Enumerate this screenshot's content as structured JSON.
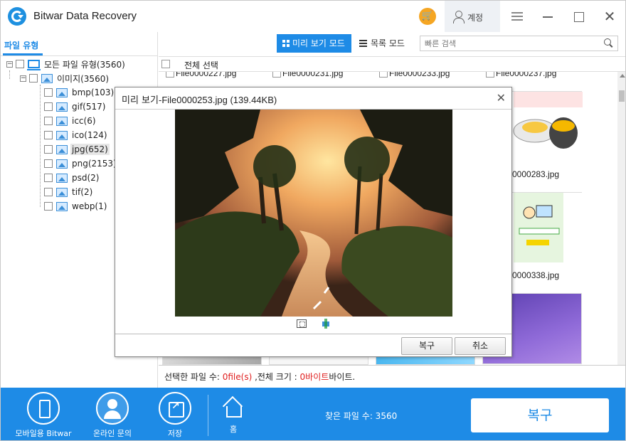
{
  "app": {
    "title": "Bitwar Data Recovery",
    "account_label": "계정"
  },
  "left_panel": {
    "tab_label": "파일 유형",
    "root": {
      "label": "모든 파일 유형(3560)",
      "expander": "−"
    },
    "group": {
      "label": "이미지(3560)",
      "expander": "−"
    },
    "items": [
      {
        "label": "bmp(103)"
      },
      {
        "label": "gif(517)"
      },
      {
        "label": "icc(6)"
      },
      {
        "label": "ico(124)"
      },
      {
        "label": "jpg(652)"
      },
      {
        "label": "png(2153)"
      },
      {
        "label": "psd(2)"
      },
      {
        "label": "tif(2)"
      },
      {
        "label": "webp(1)"
      }
    ]
  },
  "toolbar": {
    "preview_mode_label": "미리 보기 모드",
    "list_mode_label": "목록 모드",
    "search_placeholder": "빠른 검색"
  },
  "grid": {
    "select_all_label": "전체 선택",
    "top_files": [
      "File0000227.jpg",
      "File0000231.jpg",
      "File0000233.jpg",
      "File0000237.jpg"
    ],
    "visible_files": [
      "0000283.jpg",
      "0000338.jpg"
    ]
  },
  "status": {
    "prefix": "선택한 파일 수: ",
    "count": "0file(s)",
    "middle": " ,전체 크기 : ",
    "size": "0바이트",
    "suffix": "바이트."
  },
  "bottom": {
    "mobile_label": "모바일용 Bitwar",
    "support_label": "온라인 문의",
    "save_label": "저장",
    "home_label": "홈",
    "found_label": "찾은 파일 수: 3560",
    "recover_label": "복구"
  },
  "dialog": {
    "title_prefix": "미리 보기",
    "title_file": "-File0000253.jpg (139.44KB)",
    "recover_label": "복구",
    "cancel_label": "취소"
  },
  "colors": {
    "accent": "#1e8be6",
    "cart": "#f5a623",
    "status_red": "#e02020"
  }
}
